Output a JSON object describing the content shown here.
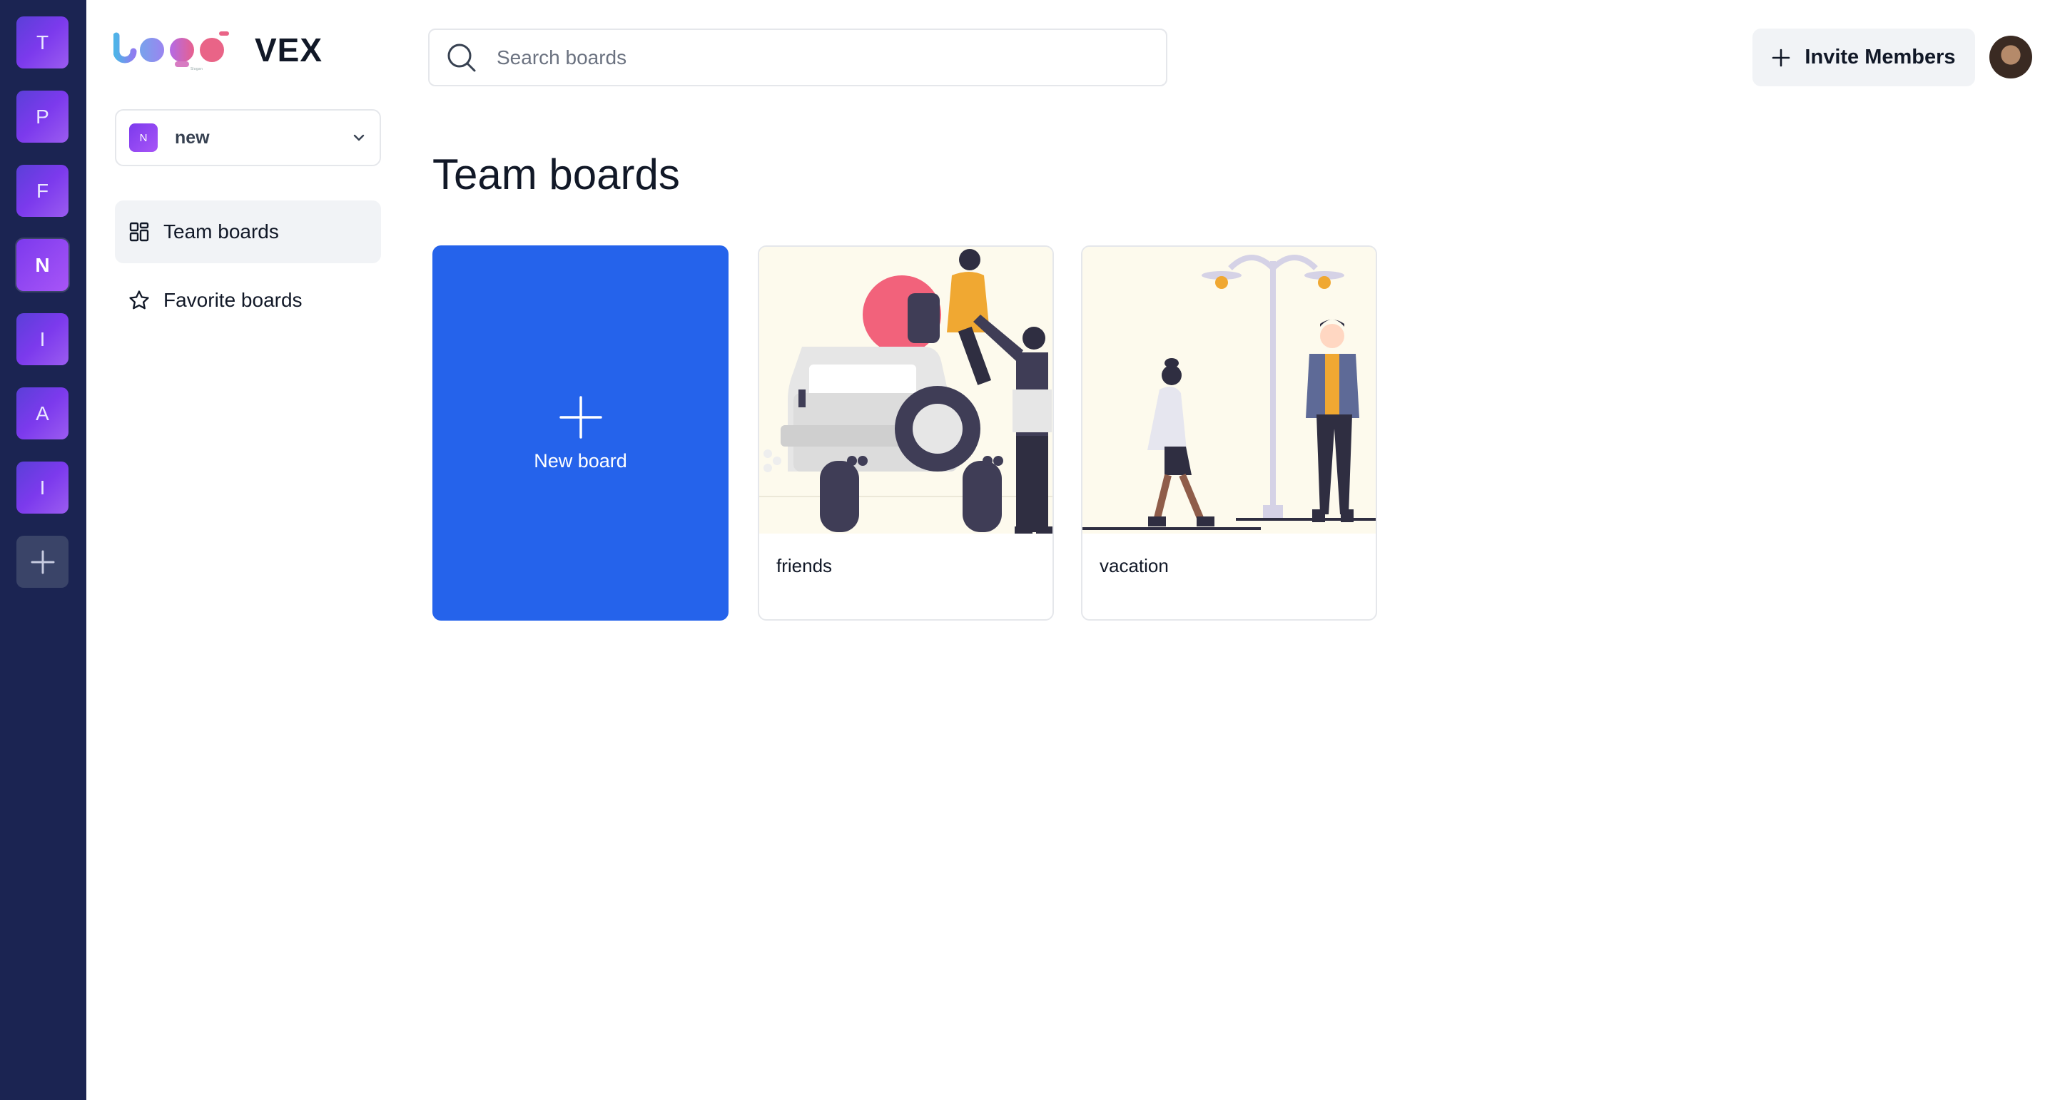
{
  "app": {
    "brand_name": "VEX",
    "logo_text": "Logo"
  },
  "org_rail": {
    "items": [
      {
        "letter": "T"
      },
      {
        "letter": "P"
      },
      {
        "letter": "F"
      },
      {
        "letter": "N",
        "active": true
      },
      {
        "letter": "I"
      },
      {
        "letter": "A"
      },
      {
        "letter": "I"
      }
    ],
    "add_icon": "plus-icon"
  },
  "sidebar": {
    "org_select": {
      "badge": "N",
      "label": "new",
      "icon": "chevron-down-icon"
    },
    "nav": [
      {
        "label": "Team boards",
        "icon": "dashboard-icon",
        "active": true
      },
      {
        "label": "Favorite boards",
        "icon": "star-icon",
        "active": false
      }
    ]
  },
  "header": {
    "search": {
      "placeholder": "Search boards",
      "value": "",
      "icon": "search-icon"
    },
    "invite_label": "Invite Members"
  },
  "main": {
    "title": "Team boards",
    "new_board_label": "New board",
    "boards": [
      {
        "name": "friends",
        "illustration": "jeep-friends-illustration"
      },
      {
        "name": "vacation",
        "illustration": "street-lamp-walking-illustration"
      }
    ]
  },
  "colors": {
    "rail": "#1b2452",
    "org_gradient_start": "#5b3fd8",
    "org_gradient_end": "#9b5cf0",
    "primary": "#2563eb",
    "card_art_bg": "#fdfaed"
  }
}
